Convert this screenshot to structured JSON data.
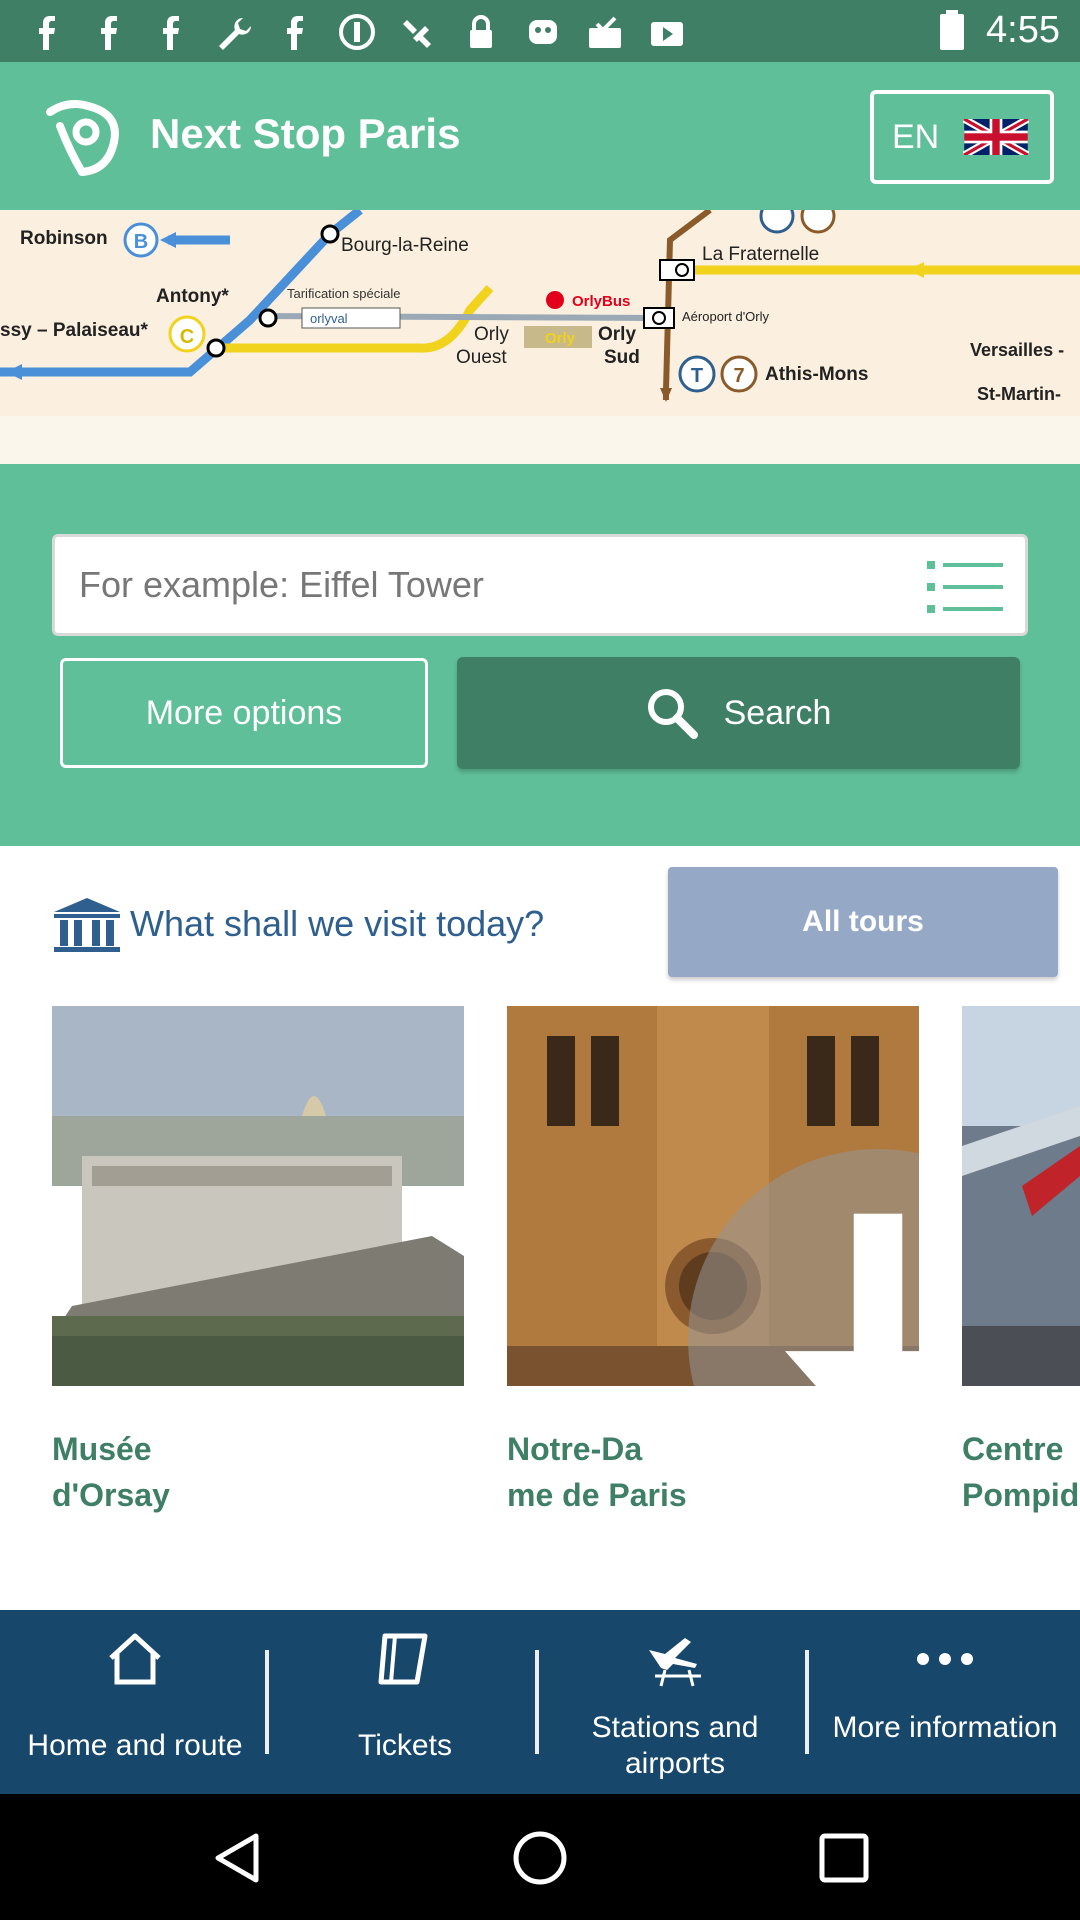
{
  "status_bar": {
    "time": "4:55",
    "icons": [
      "facebook-icon",
      "facebook-icon",
      "facebook-icon",
      "wrench-icon",
      "facebook-icon",
      "circle-p-icon",
      "satellite-icon",
      "lock-icon",
      "cup-icon",
      "mail-check-icon",
      "video-icon"
    ]
  },
  "header": {
    "title": "Next Stop Paris",
    "language_code": "EN"
  },
  "map": {
    "labels": {
      "robinson": "Robinson",
      "bourg_la_reine": "Bourg-la-Reine",
      "antony": "Antony*",
      "tarification": "Tarification spéciale",
      "orlyval": "orlyval",
      "orlybus": "OrlyBus",
      "massy": "ssy – Palaiseau*",
      "orly_ouest_1": "Orly",
      "orly_ouest_2": "Ouest",
      "orly_badge": "Orly",
      "orly_sud_1": "Orly",
      "orly_sud_2": "Sud",
      "la_fraternelle": "La Fraternelle",
      "aeroport": "Aéroport d'Orly",
      "athis_mons": "Athis-Mons",
      "versailles": "Versailles -",
      "st_martin": "St-Martin-",
      "line_b": "B",
      "line_c": "C",
      "line_t": "T",
      "line_7": "7"
    }
  },
  "search": {
    "placeholder": "For example: Eiffel Tower",
    "more_options_label": "More options",
    "search_label": "Search"
  },
  "tours": {
    "heading": "What shall we visit today?",
    "all_tours_label": "All tours",
    "cards": [
      {
        "name": "Musée\nd'Orsay"
      },
      {
        "name": "Notre-Da\nme de Paris"
      },
      {
        "name": "Centre\nPompid"
      }
    ]
  },
  "bottom_nav": {
    "items": [
      {
        "label": "Home and route"
      },
      {
        "label": "Tickets"
      },
      {
        "label": "Stations and\nairports"
      },
      {
        "label": "More\ninformation"
      }
    ]
  },
  "colors": {
    "header_green": "#5fbf98",
    "dark_green": "#3f7f66",
    "nav_blue": "#17476a",
    "all_tours": "#95a9c6",
    "heading_blue": "#2f5f8f"
  }
}
